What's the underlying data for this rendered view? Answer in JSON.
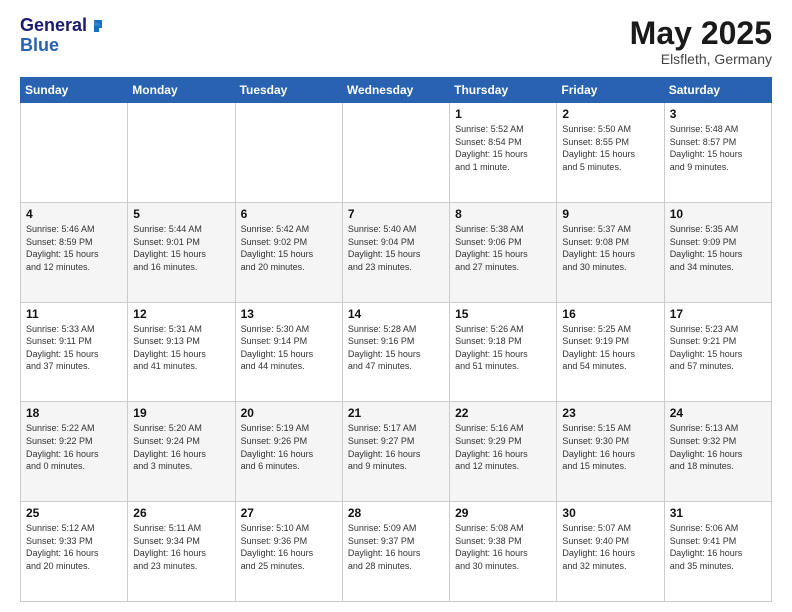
{
  "header": {
    "logo_line1": "General",
    "logo_line2": "Blue",
    "title": "May 2025",
    "location": "Elsfleth, Germany"
  },
  "days_of_week": [
    "Sunday",
    "Monday",
    "Tuesday",
    "Wednesday",
    "Thursday",
    "Friday",
    "Saturday"
  ],
  "weeks": [
    [
      {
        "day": "",
        "info": ""
      },
      {
        "day": "",
        "info": ""
      },
      {
        "day": "",
        "info": ""
      },
      {
        "day": "",
        "info": ""
      },
      {
        "day": "1",
        "info": "Sunrise: 5:52 AM\nSunset: 8:54 PM\nDaylight: 15 hours\nand 1 minute."
      },
      {
        "day": "2",
        "info": "Sunrise: 5:50 AM\nSunset: 8:55 PM\nDaylight: 15 hours\nand 5 minutes."
      },
      {
        "day": "3",
        "info": "Sunrise: 5:48 AM\nSunset: 8:57 PM\nDaylight: 15 hours\nand 9 minutes."
      }
    ],
    [
      {
        "day": "4",
        "info": "Sunrise: 5:46 AM\nSunset: 8:59 PM\nDaylight: 15 hours\nand 12 minutes."
      },
      {
        "day": "5",
        "info": "Sunrise: 5:44 AM\nSunset: 9:01 PM\nDaylight: 15 hours\nand 16 minutes."
      },
      {
        "day": "6",
        "info": "Sunrise: 5:42 AM\nSunset: 9:02 PM\nDaylight: 15 hours\nand 20 minutes."
      },
      {
        "day": "7",
        "info": "Sunrise: 5:40 AM\nSunset: 9:04 PM\nDaylight: 15 hours\nand 23 minutes."
      },
      {
        "day": "8",
        "info": "Sunrise: 5:38 AM\nSunset: 9:06 PM\nDaylight: 15 hours\nand 27 minutes."
      },
      {
        "day": "9",
        "info": "Sunrise: 5:37 AM\nSunset: 9:08 PM\nDaylight: 15 hours\nand 30 minutes."
      },
      {
        "day": "10",
        "info": "Sunrise: 5:35 AM\nSunset: 9:09 PM\nDaylight: 15 hours\nand 34 minutes."
      }
    ],
    [
      {
        "day": "11",
        "info": "Sunrise: 5:33 AM\nSunset: 9:11 PM\nDaylight: 15 hours\nand 37 minutes."
      },
      {
        "day": "12",
        "info": "Sunrise: 5:31 AM\nSunset: 9:13 PM\nDaylight: 15 hours\nand 41 minutes."
      },
      {
        "day": "13",
        "info": "Sunrise: 5:30 AM\nSunset: 9:14 PM\nDaylight: 15 hours\nand 44 minutes."
      },
      {
        "day": "14",
        "info": "Sunrise: 5:28 AM\nSunset: 9:16 PM\nDaylight: 15 hours\nand 47 minutes."
      },
      {
        "day": "15",
        "info": "Sunrise: 5:26 AM\nSunset: 9:18 PM\nDaylight: 15 hours\nand 51 minutes."
      },
      {
        "day": "16",
        "info": "Sunrise: 5:25 AM\nSunset: 9:19 PM\nDaylight: 15 hours\nand 54 minutes."
      },
      {
        "day": "17",
        "info": "Sunrise: 5:23 AM\nSunset: 9:21 PM\nDaylight: 15 hours\nand 57 minutes."
      }
    ],
    [
      {
        "day": "18",
        "info": "Sunrise: 5:22 AM\nSunset: 9:22 PM\nDaylight: 16 hours\nand 0 minutes."
      },
      {
        "day": "19",
        "info": "Sunrise: 5:20 AM\nSunset: 9:24 PM\nDaylight: 16 hours\nand 3 minutes."
      },
      {
        "day": "20",
        "info": "Sunrise: 5:19 AM\nSunset: 9:26 PM\nDaylight: 16 hours\nand 6 minutes."
      },
      {
        "day": "21",
        "info": "Sunrise: 5:17 AM\nSunset: 9:27 PM\nDaylight: 16 hours\nand 9 minutes."
      },
      {
        "day": "22",
        "info": "Sunrise: 5:16 AM\nSunset: 9:29 PM\nDaylight: 16 hours\nand 12 minutes."
      },
      {
        "day": "23",
        "info": "Sunrise: 5:15 AM\nSunset: 9:30 PM\nDaylight: 16 hours\nand 15 minutes."
      },
      {
        "day": "24",
        "info": "Sunrise: 5:13 AM\nSunset: 9:32 PM\nDaylight: 16 hours\nand 18 minutes."
      }
    ],
    [
      {
        "day": "25",
        "info": "Sunrise: 5:12 AM\nSunset: 9:33 PM\nDaylight: 16 hours\nand 20 minutes."
      },
      {
        "day": "26",
        "info": "Sunrise: 5:11 AM\nSunset: 9:34 PM\nDaylight: 16 hours\nand 23 minutes."
      },
      {
        "day": "27",
        "info": "Sunrise: 5:10 AM\nSunset: 9:36 PM\nDaylight: 16 hours\nand 25 minutes."
      },
      {
        "day": "28",
        "info": "Sunrise: 5:09 AM\nSunset: 9:37 PM\nDaylight: 16 hours\nand 28 minutes."
      },
      {
        "day": "29",
        "info": "Sunrise: 5:08 AM\nSunset: 9:38 PM\nDaylight: 16 hours\nand 30 minutes."
      },
      {
        "day": "30",
        "info": "Sunrise: 5:07 AM\nSunset: 9:40 PM\nDaylight: 16 hours\nand 32 minutes."
      },
      {
        "day": "31",
        "info": "Sunrise: 5:06 AM\nSunset: 9:41 PM\nDaylight: 16 hours\nand 35 minutes."
      }
    ]
  ]
}
